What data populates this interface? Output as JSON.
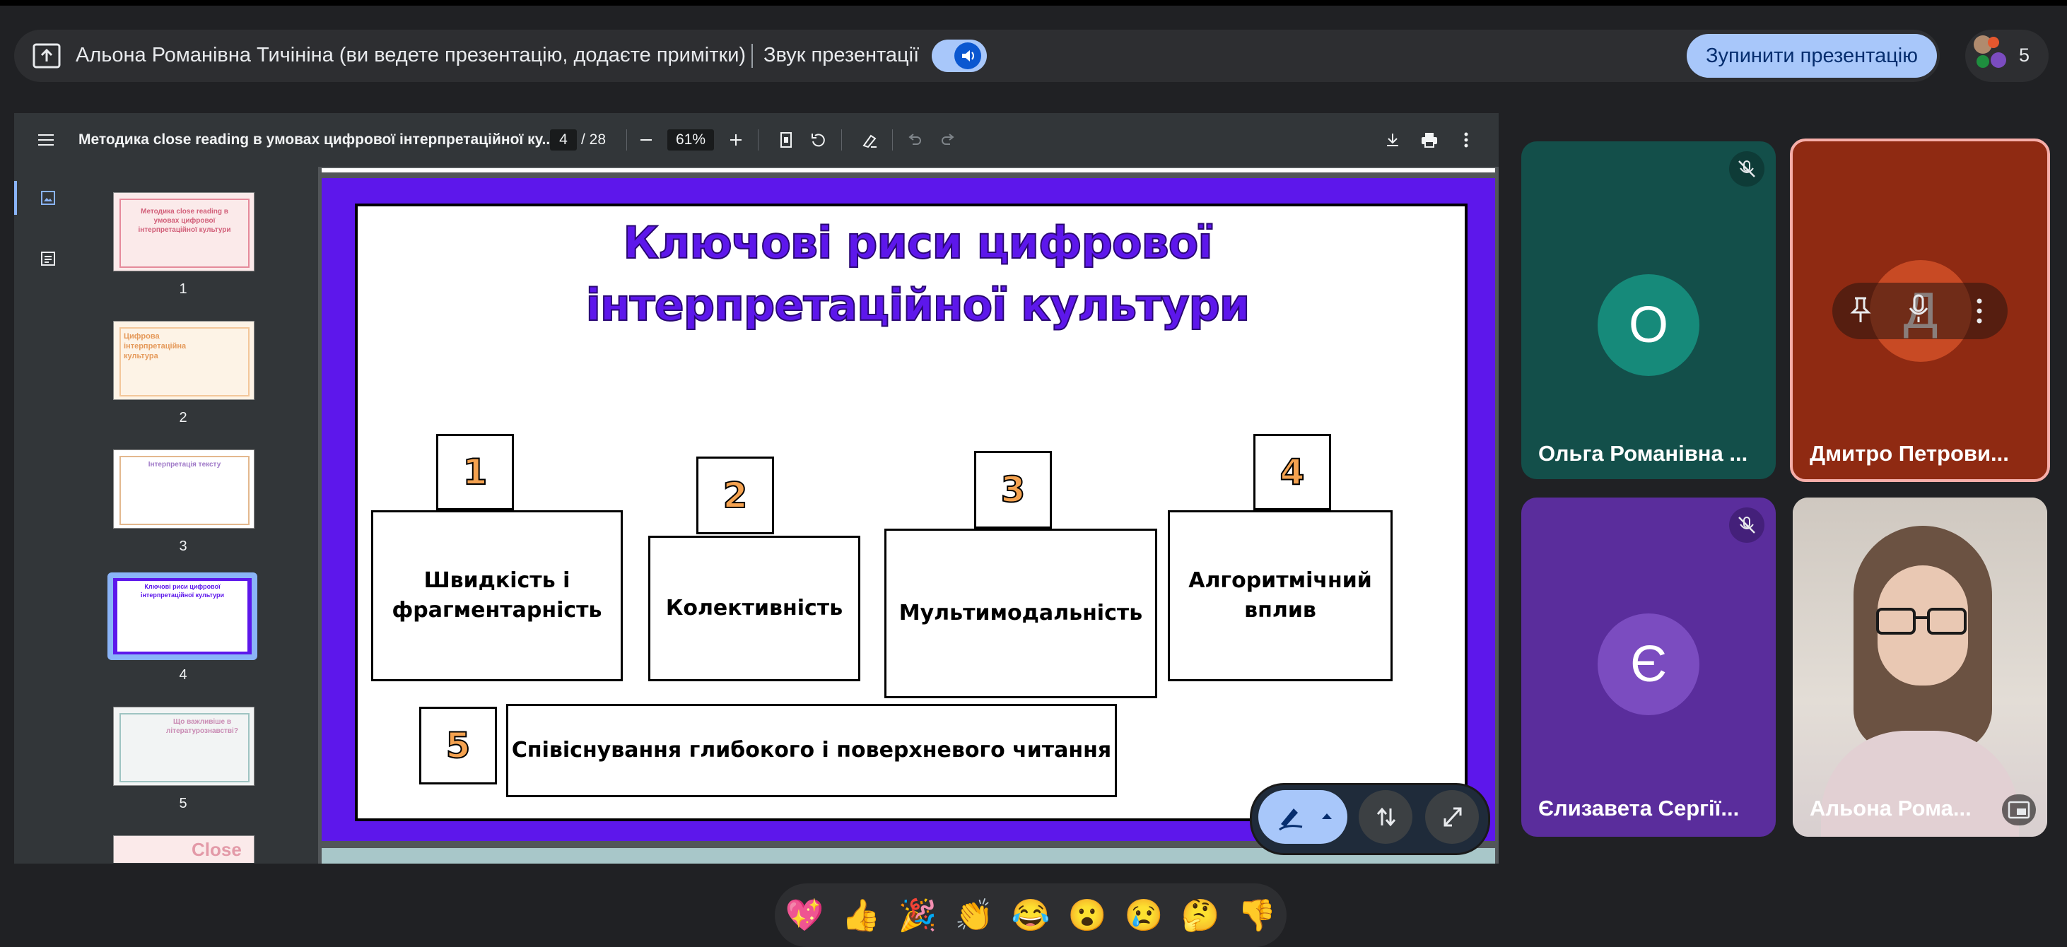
{
  "banner": {
    "presenter_text": "Альона Романівна Тичініна (ви ведете презентацію, додаєте примітки)",
    "sound_label": "Звук презентації",
    "stop_button": "Зупинити презентацію",
    "participant_count": "5"
  },
  "pdf": {
    "title": "Методика close reading в умовах цифрової інтерпретаційної ку...",
    "page_current": "4",
    "page_total": "/ 28",
    "zoom": "61%",
    "thumbnails": [
      {
        "num": "1",
        "caption": "Методика close reading в умовах цифрової інтерпретаційної культури"
      },
      {
        "num": "2",
        "caption": "Цифрова інтерпретаційна культура"
      },
      {
        "num": "3",
        "caption": "Інтерпретація тексту"
      },
      {
        "num": "4",
        "caption": "Ключові риси цифрової інтерпретаційної культури"
      },
      {
        "num": "5",
        "caption": "Що важливіше в літературознавстві?"
      },
      {
        "num": "",
        "caption": "Close"
      }
    ]
  },
  "slide": {
    "title_line1": "Ключові риси цифрової",
    "title_line2": "інтерпретаційної культури",
    "items": [
      {
        "num": "1",
        "line1": "Швидкість і",
        "line2": "фрагментарність"
      },
      {
        "num": "2",
        "line1": "Колективність",
        "line2": ""
      },
      {
        "num": "3",
        "line1": "Мультимодальність",
        "line2": ""
      },
      {
        "num": "4",
        "line1": "Алгоритмічний",
        "line2": "вплив"
      },
      {
        "num": "5",
        "line1": "Співіснування глибокого і поверхневого читання",
        "line2": ""
      }
    ]
  },
  "tiles": [
    {
      "name": "Ольга Романівна ...",
      "initial": "О",
      "bg": "#134f4a",
      "circle": "#168a7a",
      "muted": true
    },
    {
      "name": "Дмитро Петрови...",
      "initial": "Д",
      "bg": "#8f2a12",
      "circle": "#c84a24",
      "muted": false
    },
    {
      "name": "Єлизавета Сергії...",
      "initial": "Є",
      "bg": "#5a2d9c",
      "circle": "#7b4cc0",
      "muted": true
    },
    {
      "name": "Альона Рома...",
      "initial": "",
      "bg": "#d9d3cc",
      "circle": "",
      "muted": false
    }
  ],
  "reactions": [
    "💖",
    "👍",
    "🎉",
    "👏",
    "😂",
    "😮",
    "😢",
    "🤔",
    "👎"
  ],
  "colors": {
    "accent": "#a8c7fa",
    "slide_purple": "#5d17eb",
    "number_orange": "#f4a250",
    "speaking_border": "#f6aea9"
  }
}
